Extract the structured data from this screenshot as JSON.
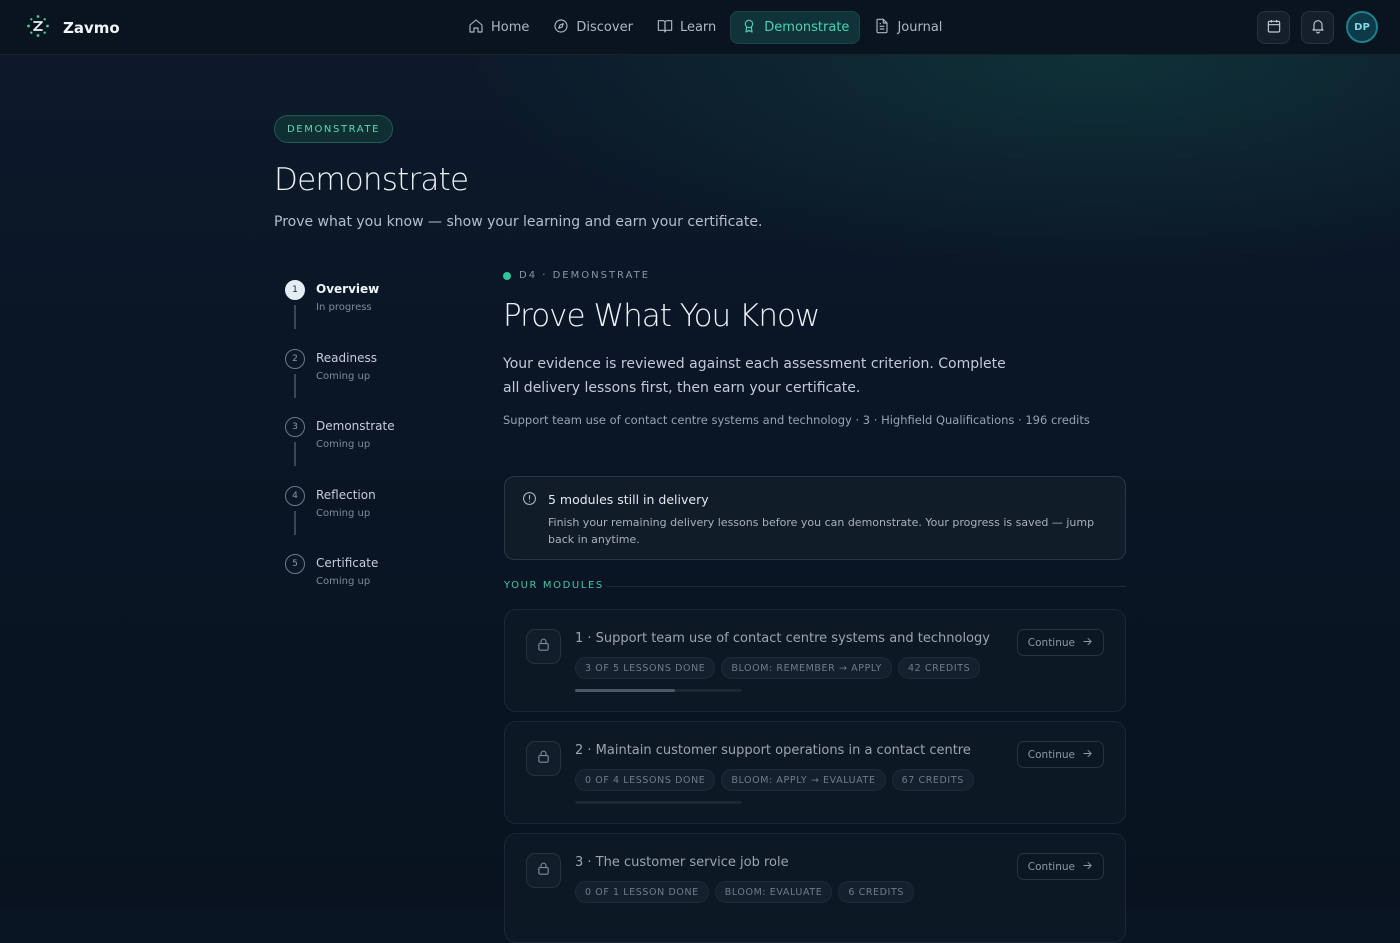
{
  "app": {
    "name": "Zavmo",
    "logo_icon": "sparkle-logo-icon"
  },
  "nav": {
    "items": [
      {
        "label": "Home",
        "icon": "home-icon"
      },
      {
        "label": "Discover",
        "icon": "compass-icon"
      },
      {
        "label": "Learn",
        "icon": "book-open-icon"
      },
      {
        "label": "Demonstrate",
        "icon": "award-icon",
        "active": true
      },
      {
        "label": "Journal",
        "icon": "document-icon"
      }
    ],
    "calendar_icon": "calendar-icon",
    "bell_icon": "bell-icon",
    "avatar_initials": "DP"
  },
  "hero": {
    "pill": "DEMONSTRATE",
    "title": "Demonstrate",
    "subtitle": "Prove what you know — show your learning and earn your certificate."
  },
  "steps": [
    {
      "number": "1",
      "name": "Overview",
      "state": "In progress",
      "current": true
    },
    {
      "number": "2",
      "name": "Readiness",
      "state": "Coming up"
    },
    {
      "number": "3",
      "name": "Demonstrate",
      "state": "Coming up"
    },
    {
      "number": "4",
      "name": "Reflection",
      "state": "Coming up"
    },
    {
      "number": "5",
      "name": "Certificate",
      "state": "Coming up"
    }
  ],
  "main": {
    "eyebrow": "D4 · DEMONSTRATE",
    "title": "Prove What You Know",
    "description": "Your evidence is reviewed against each assessment criterion. Complete all delivery lessons first, then earn your certificate.",
    "meta": "Support team use of contact centre systems and technology · 3 · Highfield Qualifications · 196 credits"
  },
  "notice": {
    "icon": "info-circle-icon",
    "title": "5 modules still in delivery",
    "body": "Finish your remaining delivery lessons before you can demonstrate. Your progress is saved — jump back in anytime."
  },
  "modules_section": {
    "label": "YOUR MODULES"
  },
  "modules": [
    {
      "title": "1 · Support team use of contact centre systems and technology",
      "lessons": "3 OF 5 LESSONS DONE",
      "bloom": "BLOOM: REMEMBER → APPLY",
      "credits": "42 CREDITS",
      "progress": 0.6,
      "action": "Continue"
    },
    {
      "title": "2 · Maintain customer support operations in a contact centre",
      "lessons": "0 OF 4 LESSONS DONE",
      "bloom": "BLOOM: APPLY → EVALUATE",
      "credits": "67 CREDITS",
      "progress": 0,
      "action": "Continue"
    },
    {
      "title": "3 · The customer service job role",
      "lessons": "0 OF 1 LESSON DONE",
      "bloom": "BLOOM: EVALUATE",
      "credits": "6 CREDITS",
      "progress": 0,
      "action": "Continue"
    }
  ],
  "colors": {
    "accent": "#4fd1b0",
    "background": "#0a1524",
    "card": "#0d1825"
  }
}
